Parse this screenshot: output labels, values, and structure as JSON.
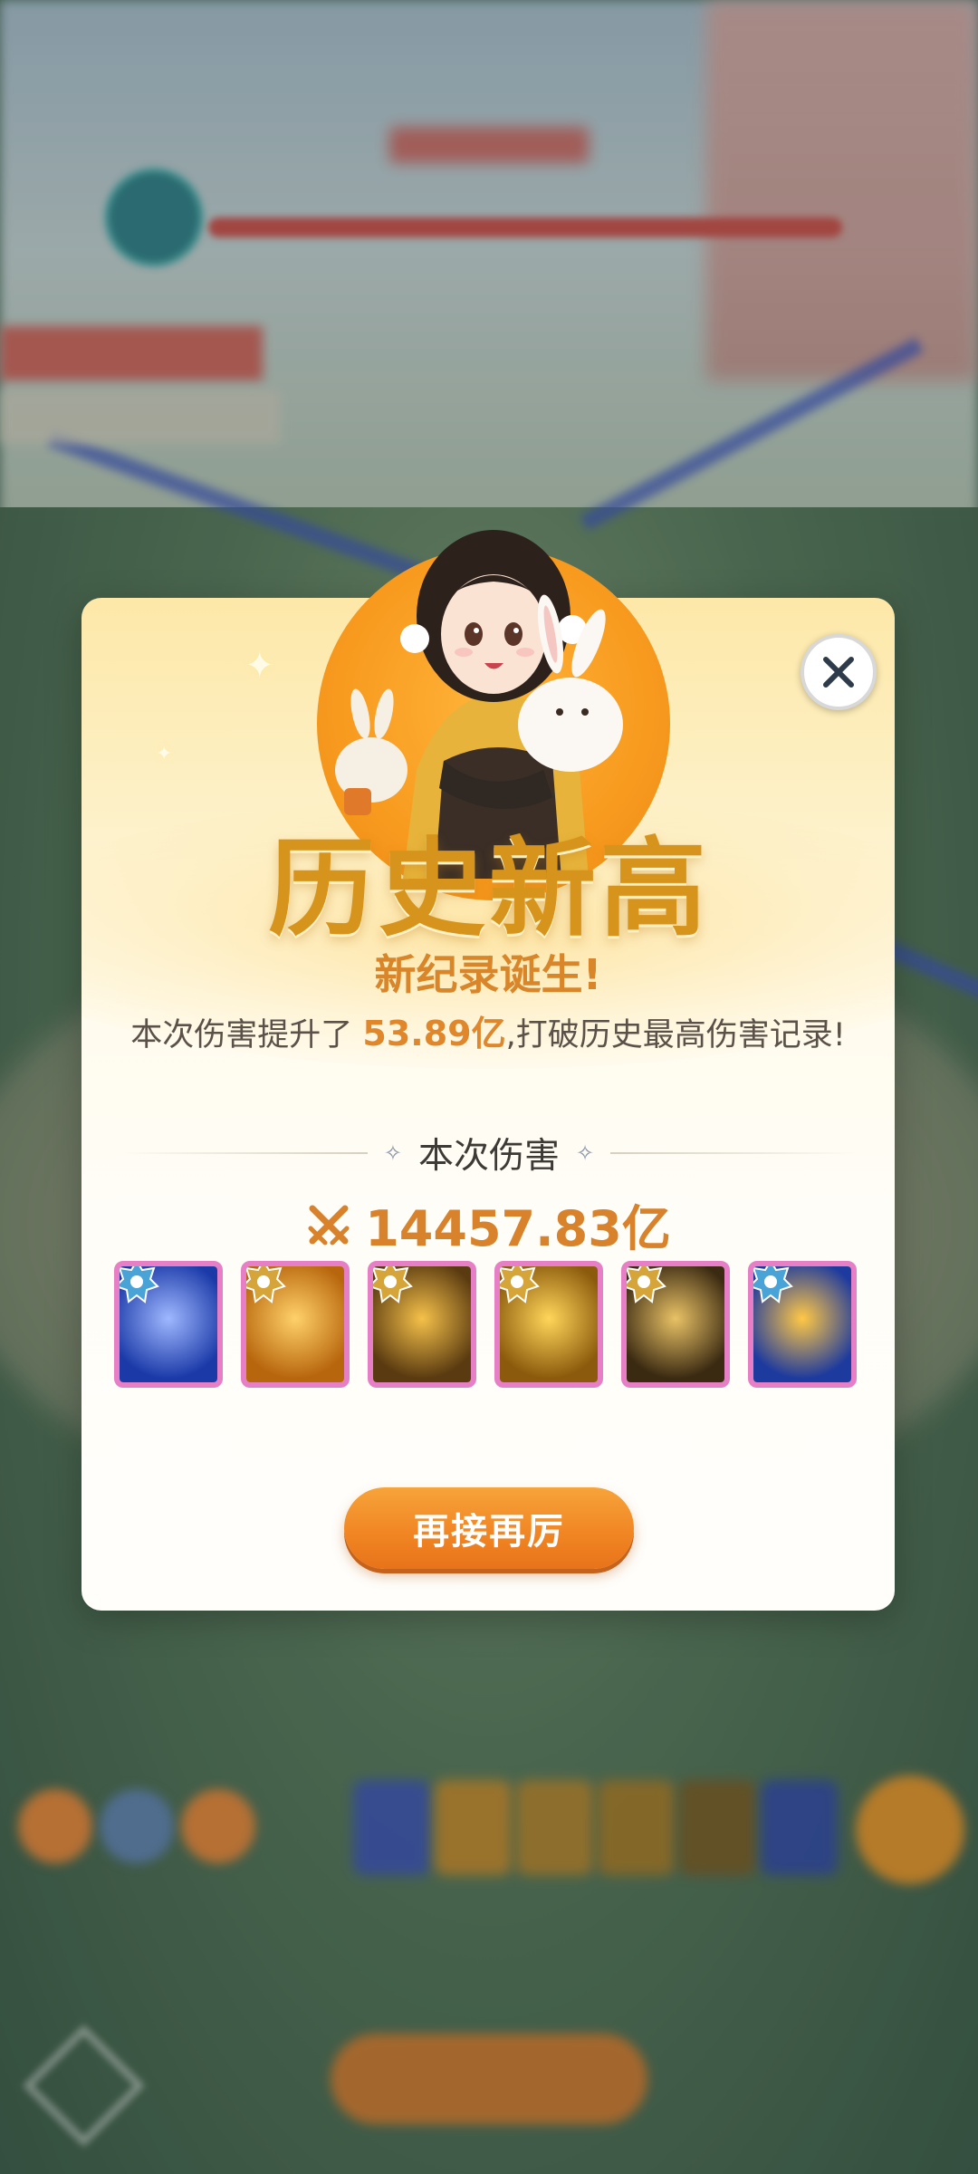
{
  "popup": {
    "title": "历史新高",
    "subtitle": "新纪录诞生!",
    "description_prefix": "本次伤害提升了 ",
    "description_value": "53.89亿",
    "description_suffix": ",打破历史最高伤害记录!",
    "section_label": "本次伤害",
    "damage_value": "14457.83亿",
    "again_button_label": "再接再厉",
    "close_icon": "close-icon",
    "skills": [
      {
        "name": "frost-bell-skill-icon",
        "badge": "water-badge",
        "colors": [
          "#1b3aa8",
          "#9fb8ff"
        ]
      },
      {
        "name": "golden-dancer-skill-icon",
        "badge": "gold-badge",
        "colors": [
          "#b8660d",
          "#ffd16a"
        ]
      },
      {
        "name": "golden-dragon-skill-icon",
        "badge": "gold-badge",
        "colors": [
          "#5a3a10",
          "#f5c14a"
        ]
      },
      {
        "name": "golden-phoenix-skill-icon",
        "badge": "gold-badge",
        "colors": [
          "#8b5a0c",
          "#ffd65a"
        ]
      },
      {
        "name": "golden-sword-skill-icon",
        "badge": "gold-badge",
        "colors": [
          "#3b2a12",
          "#e9c266"
        ]
      },
      {
        "name": "lightning-orb-skill-icon",
        "badge": "water-badge",
        "colors": [
          "#1d3a9e",
          "#ffc845"
        ]
      }
    ]
  },
  "colors": {
    "accent_orange": "#e0862b",
    "title_gold": "#d7941d",
    "skill_border": "#e77fc7"
  }
}
